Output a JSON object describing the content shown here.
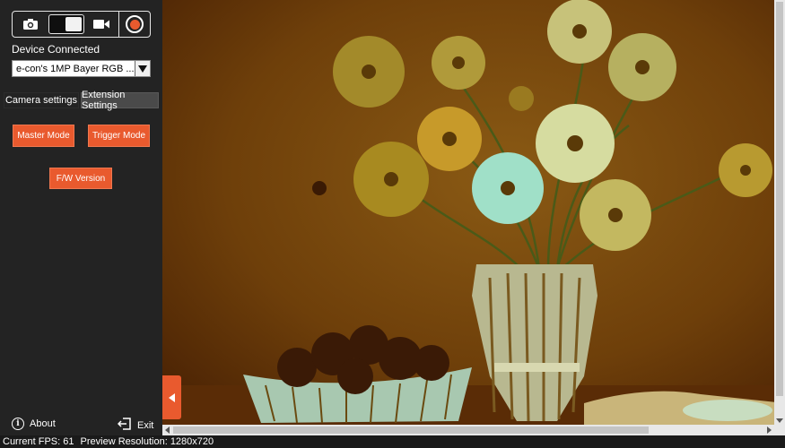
{
  "sidebar": {
    "mode_bar": {
      "photo_icon": "camera-icon",
      "video_icon": "video-camera-icon",
      "record_icon": "record-icon",
      "record_color": "#e95a2e",
      "toggle_state": "video"
    },
    "device_connected_label": "Device Connected",
    "device_select_value": "e-con's 1MP Bayer RGB ...",
    "tabs": [
      {
        "label": "Camera settings",
        "active": false
      },
      {
        "label": "Extension Settings",
        "active": true
      }
    ],
    "extension": {
      "master_mode_label": "Master Mode",
      "trigger_mode_label": "Trigger Mode",
      "fw_version_label": "F/W Version"
    },
    "about_label": "About",
    "exit_label": "Exit"
  },
  "status_bar": {
    "fps_text": "Current FPS: 61",
    "resolution_text": "Preview Resolution: 1280x720"
  },
  "colors": {
    "accent": "#e95a2e",
    "sidebar_bg": "#232323",
    "preview_bg": "#6a3808"
  }
}
